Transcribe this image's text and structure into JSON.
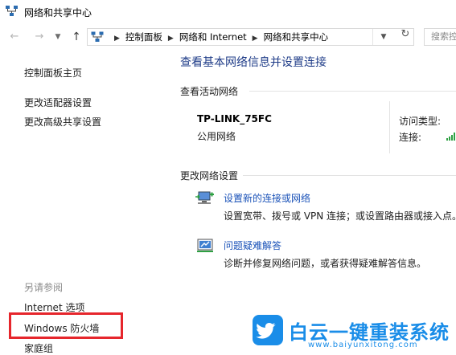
{
  "window": {
    "title": "网络和共享中心"
  },
  "nav": {
    "back_icon": "back-arrow-icon",
    "forward_icon": "forward-arrow-icon",
    "up_icon": "up-arrow-icon",
    "breadcrumbs": [
      "控制面板",
      "网络和 Internet",
      "网络和共享中心"
    ],
    "search_placeholder": "搜索控制"
  },
  "sidebar": {
    "items": [
      "控制面板主页",
      "更改适配器设置",
      "更改高级共享设置"
    ],
    "see_also_label": "另请参阅",
    "see_also_items": [
      "Internet 选项",
      "Windows 防火墙",
      "家庭组"
    ]
  },
  "main": {
    "heading": "查看基本网络信息并设置连接",
    "active_networks_label": "查看活动网络",
    "network": {
      "name": "TP-LINK_75FC",
      "type": "公用网络",
      "access_type_label": "访问类型:",
      "connections_label": "连接:"
    },
    "change_settings_label": "更改网络设置",
    "tasks": [
      {
        "link": "设置新的连接或网络",
        "desc": "设置宽带、拨号或 VPN 连接；或设置路由器或接入点。",
        "icon": "new-connection-icon"
      },
      {
        "link": "问题疑难解答",
        "desc": "诊断并修复网络问题，或者获得疑难解答信息。",
        "icon": "troubleshoot-icon"
      }
    ]
  },
  "watermark": {
    "text": "白云一键重装系统",
    "url": "www.baiyunxitong.com"
  },
  "colors": {
    "heading": "#1f3c88",
    "link": "#1a52b8",
    "highlight": "#e6262c",
    "watermark": "#1a8de8"
  }
}
